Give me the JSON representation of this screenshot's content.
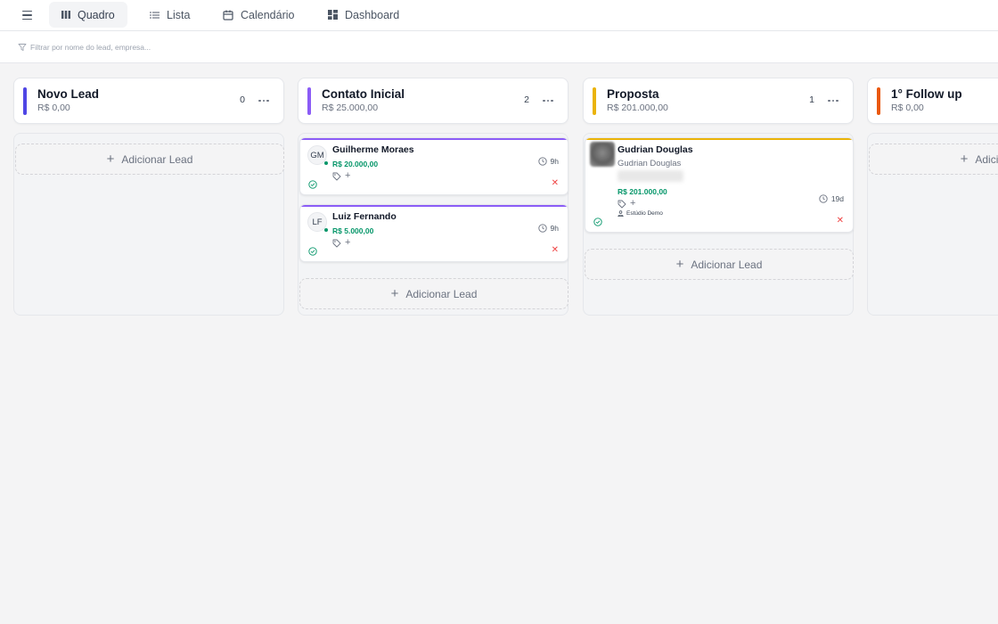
{
  "tabs": [
    {
      "label": "Quadro",
      "icon": "kanban-icon",
      "active": true
    },
    {
      "label": "Lista",
      "icon": "list-icon",
      "active": false
    },
    {
      "label": "Calendário",
      "icon": "calendar-icon",
      "active": false
    },
    {
      "label": "Dashboard",
      "icon": "dashboard-icon",
      "active": false
    }
  ],
  "filter": {
    "placeholder": "Filtrar por nome do lead, empresa..."
  },
  "add_lead_label": "Adicionar Lead",
  "columns": [
    {
      "title": "Novo Lead",
      "total": "R$ 0,00",
      "count": "0",
      "color": "#4f46e5"
    },
    {
      "title": "Contato Inicial",
      "total": "R$ 25.000,00",
      "count": "2",
      "color": "#8b5cf6"
    },
    {
      "title": "Proposta",
      "total": "R$ 201.000,00",
      "count": "1",
      "color": "#eab308"
    },
    {
      "title": "1° Follow up",
      "total": "R$ 0,00",
      "count": "",
      "color": "#ea580c"
    }
  ],
  "cards": {
    "contato_inicial": [
      {
        "initials": "GM",
        "name": "Guilherme Moraes",
        "value": "R$ 20.000,00",
        "time": "9h"
      },
      {
        "initials": "LF",
        "name": "Luiz Fernando",
        "value": "R$ 5.000,00",
        "time": "9h"
      }
    ],
    "proposta": [
      {
        "name": "Gudrian Douglas",
        "subtitle": "Gudrian Douglas",
        "value": "R$ 201.000,00",
        "time": "19d",
        "company": "Estúdio Demo"
      }
    ]
  },
  "colors": {
    "accent_green": "#059669",
    "danger_red": "#ef4444"
  }
}
